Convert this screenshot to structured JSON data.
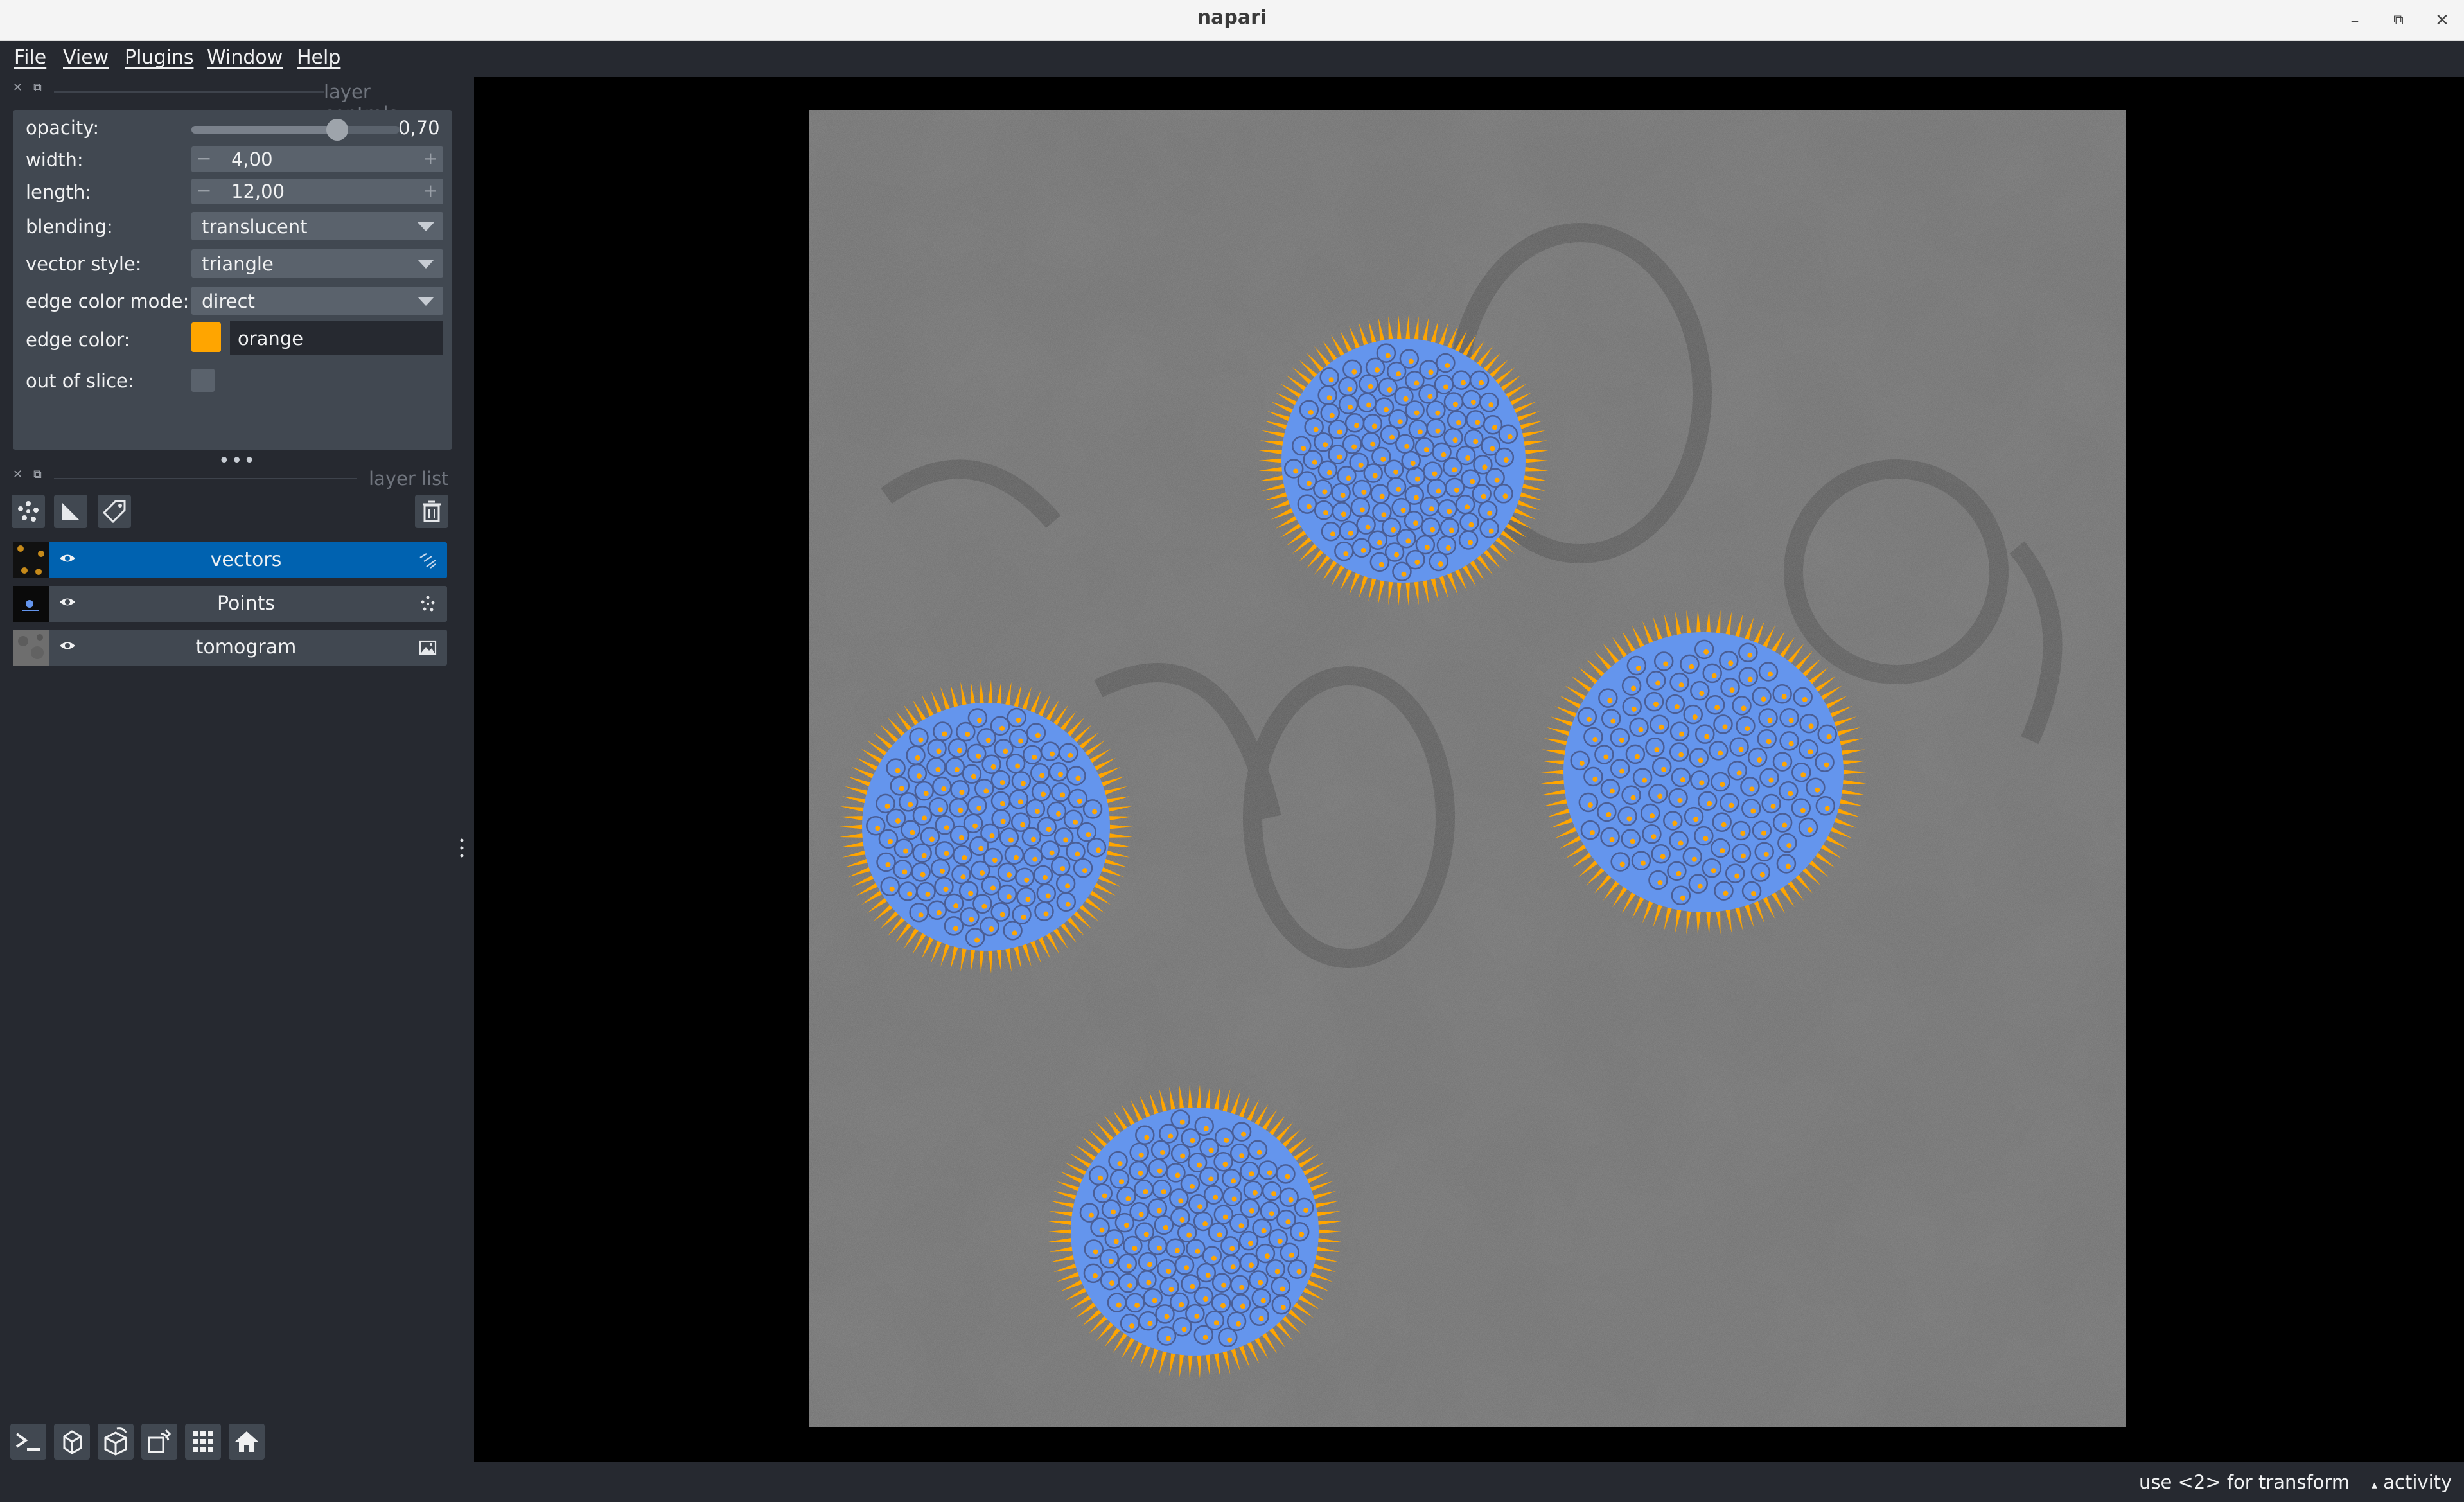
{
  "window": {
    "title": "napari"
  },
  "menu": [
    {
      "label": "File"
    },
    {
      "label": "View"
    },
    {
      "label": "Plugins"
    },
    {
      "label": "Window"
    },
    {
      "label": "Help"
    }
  ],
  "layer_controls": {
    "title": "layer controls",
    "opacity": {
      "label": "opacity:",
      "value": "0,70",
      "level": 0.7
    },
    "width": {
      "label": "width:",
      "value": "4,00"
    },
    "length": {
      "label": "length:",
      "value": "12,00"
    },
    "blending": {
      "label": "blending:",
      "value": "translucent"
    },
    "vector_style": {
      "label": "vector style:",
      "value": "triangle"
    },
    "edge_color_mode": {
      "label": "edge color mode:",
      "value": "direct"
    },
    "edge_color": {
      "label": "edge color:",
      "value": "orange",
      "swatch": "#ffa500"
    },
    "out_of_slice": {
      "label": "out of slice:",
      "checked": false
    }
  },
  "layer_list": {
    "title": "layer list",
    "layers": [
      {
        "name": "vectors",
        "selected": true,
        "visible": true,
        "type_icon": "vectors-layer-icon"
      },
      {
        "name": "Points",
        "selected": false,
        "visible": true,
        "type_icon": "points-layer-icon"
      },
      {
        "name": "tomogram",
        "selected": false,
        "visible": true,
        "type_icon": "image-layer-icon"
      }
    ]
  },
  "viewer_buttons": [
    "console-icon",
    "ndisplay-icon",
    "roll-icon",
    "transpose-icon",
    "grid-icon",
    "home-icon"
  ],
  "status": {
    "message": "use <2> for transform",
    "activity": "activity"
  },
  "colors": {
    "background": "#262930",
    "panel": "#414851",
    "selection": "#0062b0",
    "vector_edge": "#ffa500",
    "points_face": "#6495ed"
  }
}
